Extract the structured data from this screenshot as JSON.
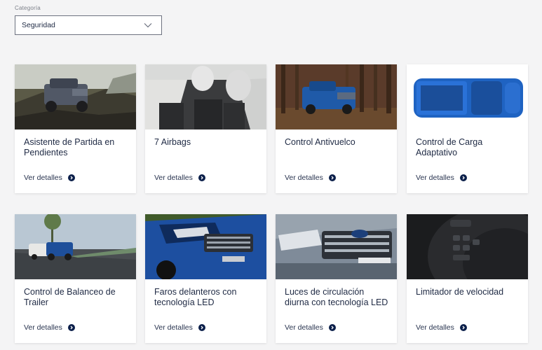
{
  "filter": {
    "label": "Categoría",
    "selected": "Seguridad"
  },
  "cards": [
    {
      "title": "Asistente de Partida en Pendientes",
      "link": "Ver detalles",
      "image": "ranger-on-rocks"
    },
    {
      "title": "7 Airbags",
      "link": "Ver detalles",
      "image": "cabin-airbags"
    },
    {
      "title": "Control Antivuelco",
      "link": "Ver detalles",
      "image": "ranger-in-forest"
    },
    {
      "title": "Control de Carga Adaptativo",
      "link": "Ver detalles",
      "image": "ranger-top-view"
    },
    {
      "title": "Control de Balanceo de Trailer",
      "link": "Ver detalles",
      "image": "ranger-towing-trailer"
    },
    {
      "title": "Faros delanteros con tecnología LED",
      "link": "Ver detalles",
      "image": "ranger-headlight-closeup"
    },
    {
      "title": "Luces de circulación diurna con tecnología LED",
      "link": "Ver detalles",
      "image": "ranger-grille-closeup"
    },
    {
      "title": "Limitador de velocidad",
      "link": "Ver detalles",
      "image": "steering-wheel-buttons"
    }
  ],
  "colors": {
    "page_bg": "#f4f4f5",
    "text": "#1f2a44",
    "arrow_circle": "#0b1f4a"
  }
}
